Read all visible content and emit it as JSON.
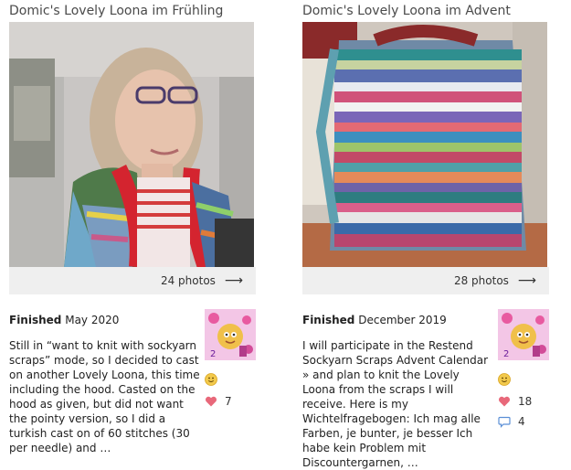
{
  "projects": [
    {
      "title": "Domic's Lovely Loona im Frühling",
      "photos": "24 photos",
      "finished_label": "Finished",
      "finished_date": "May 2020",
      "description": "Still in “want to knit with sockyarn scraps” mode, so I decided to cast on another Lovely Loona, this time including the hood. Casted on the hood as given, but did not want the pointy version, so I did a turkish cast on of 60 stitches (30 per needle) and …",
      "hearts": "7"
    },
    {
      "title": "Domic's Lovely Loona im Advent",
      "photos": "28 photos",
      "finished_label": "Finished",
      "finished_date": "December 2019",
      "description": "I will participate in the Restend Sockyarn Scraps Advent Calendar » and plan to knit the Lovely Loona from the scraps I will receive. Here is my Wichtelfragebogen: Ich mag alle Farben, je bunter, je besser Ich habe kein Problem mit Discountergarnen, …",
      "hearts": "18",
      "comments": "4"
    }
  ],
  "icons": {
    "arrow": "arrow-right-icon",
    "smiley": "smiley-icon",
    "heart": "heart-icon",
    "comment": "comment-icon",
    "avatar": "user-avatar"
  },
  "colors": {
    "heart": "#e8687a",
    "comment": "#5b8fd6",
    "smiley": "#f2c94c",
    "photo_bar": "#efefef"
  }
}
